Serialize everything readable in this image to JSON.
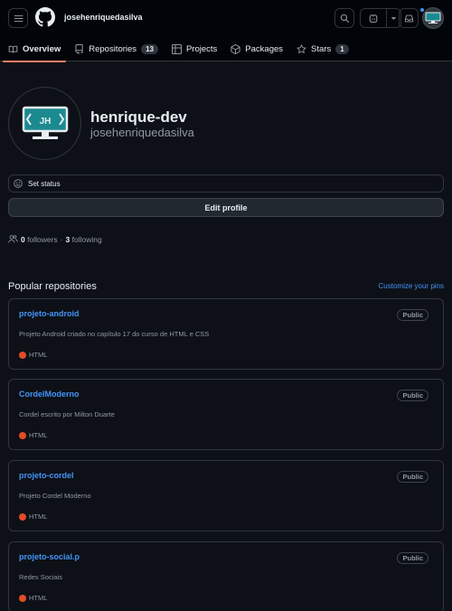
{
  "header": {
    "username": "josehenriquedasilva",
    "menu_icon": "hamburger-icon",
    "logo_icon": "github-logo-icon",
    "notification_dot_color": "#4493f8"
  },
  "tabs": [
    {
      "label": "Overview",
      "icon": "book-icon",
      "active": true
    },
    {
      "label": "Repositories",
      "icon": "repo-icon",
      "count": "13"
    },
    {
      "label": "Projects",
      "icon": "table-icon"
    },
    {
      "label": "Packages",
      "icon": "package-icon"
    },
    {
      "label": "Stars",
      "icon": "star-icon",
      "count": "1"
    }
  ],
  "profile": {
    "name": "henrique-dev",
    "login": "josehenriquedasilva",
    "avatar_text": "JH",
    "set_status": "Set status",
    "edit_profile": "Edit profile",
    "followers_count": "0",
    "followers_label": "followers",
    "separator": "·",
    "following_count": "3",
    "following_label": "following"
  },
  "popular": {
    "title": "Popular repositories",
    "customize": "Customize your pins",
    "repos": [
      {
        "name": "projeto-android",
        "visibility": "Public",
        "description": "Projeto Android criado no capítulo 17 do curso de HTML e CSS",
        "language": "HTML",
        "lang_color": "#e34c26"
      },
      {
        "name": "CordelModerno",
        "visibility": "Public",
        "description": "Cordel escrito por Milton Duarte",
        "language": "HTML",
        "lang_color": "#e34c26"
      },
      {
        "name": "projeto-cordel",
        "visibility": "Public",
        "description": "Projeto Cordel Moderno",
        "language": "HTML",
        "lang_color": "#e34c26"
      },
      {
        "name": "projeto-social.p",
        "visibility": "Public",
        "description": "Redes Sociais",
        "language": "HTML",
        "lang_color": "#e34c26"
      }
    ]
  },
  "colors": {
    "background": "#0d1117",
    "header": "#010409",
    "link": "#4493f8",
    "tab_underline": "#f78166",
    "avatar_accent": "#1b8a8f"
  }
}
